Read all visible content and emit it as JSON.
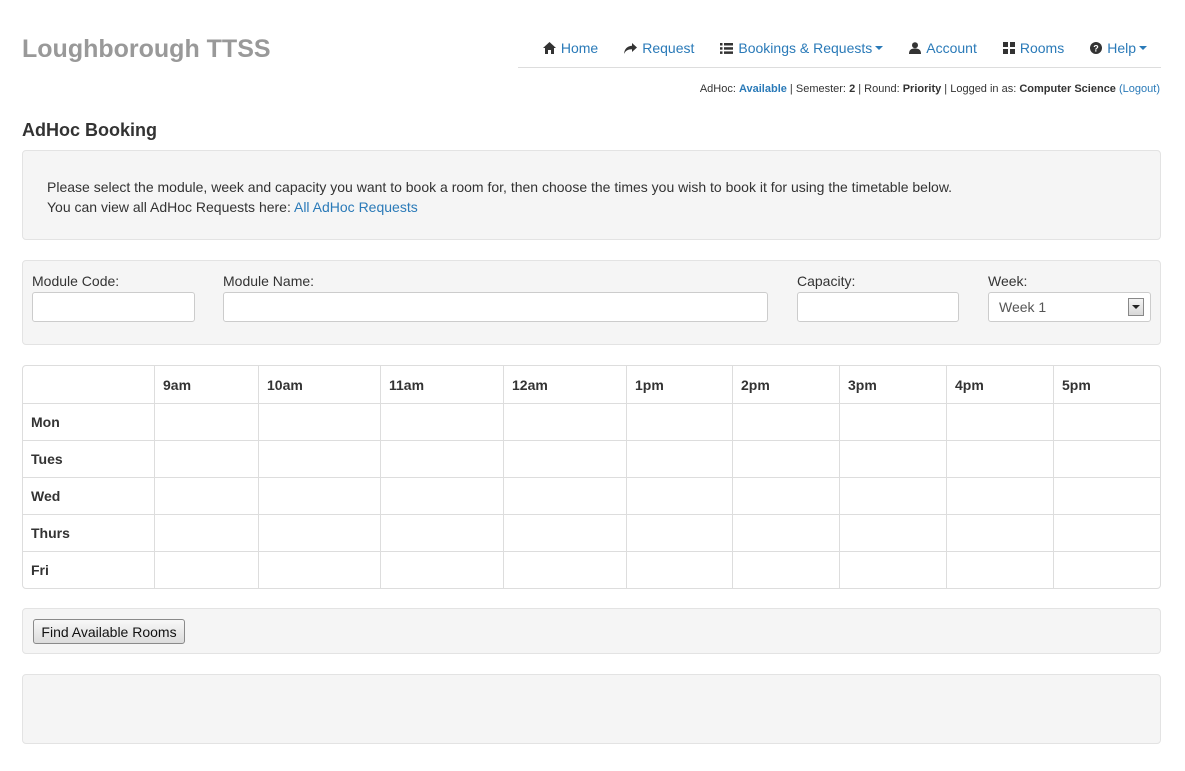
{
  "brand": "Loughborough TTSS",
  "nav": {
    "home": "Home",
    "request": "Request",
    "bookings": "Bookings & Requests",
    "account": "Account",
    "rooms": "Rooms",
    "help": "Help"
  },
  "status": {
    "adhoc_label": "AdHoc:",
    "adhoc_value": "Available",
    "semester_label": "Semester:",
    "semester_value": "2",
    "round_label": "Round:",
    "round_value": "Priority",
    "logged_label": "Logged in as:",
    "logged_value": "Computer Science",
    "logout": "Logout"
  },
  "page_title": "AdHoc Booking",
  "info": {
    "line1": "Please select the module, week and capacity you want to book a room for, then choose the times you wish to book it for using the timetable below.",
    "line2": "You can view all AdHoc Requests here:",
    "link": "All AdHoc Requests"
  },
  "form": {
    "module_code_label": "Module Code:",
    "module_code_value": "",
    "module_name_label": "Module Name:",
    "module_name_value": "",
    "capacity_label": "Capacity:",
    "capacity_value": "",
    "week_label": "Week:",
    "week_value": "Week 1"
  },
  "timetable": {
    "times": [
      "9am",
      "10am",
      "11am",
      "12am",
      "1pm",
      "2pm",
      "3pm",
      "4pm",
      "5pm"
    ],
    "days": [
      "Mon",
      "Tues",
      "Wed",
      "Thurs",
      "Fri"
    ]
  },
  "find_button": "Find Available Rooms",
  "colors": {
    "link": "#2a7ab8",
    "brand": "#999999",
    "well": "#f5f5f5"
  }
}
